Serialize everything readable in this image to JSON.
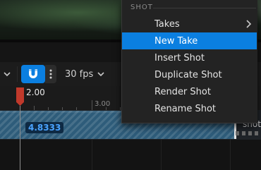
{
  "context_menu": {
    "header": "SHOT",
    "items": [
      {
        "label": "Takes",
        "has_submenu": true,
        "active": false
      },
      {
        "label": "New Take",
        "has_submenu": false,
        "active": true
      },
      {
        "label": "Insert Shot",
        "has_submenu": false,
        "active": false
      },
      {
        "label": "Duplicate Shot",
        "has_submenu": false,
        "active": false
      },
      {
        "label": "Render Shot",
        "has_submenu": false,
        "active": false
      },
      {
        "label": "Rename Shot",
        "has_submenu": false,
        "active": false
      }
    ]
  },
  "toolbar": {
    "frame_rate": "30 fps",
    "snap_enabled": true,
    "icons": [
      "chevron-down-icon",
      "magnet-icon",
      "kebab-menu-icon",
      "chevron-down-icon"
    ]
  },
  "timeline": {
    "playhead_time": "2.00",
    "ruler_label": "3.00",
    "shot_time": "4.8333",
    "next_shot_label": "snot"
  },
  "colors": {
    "accent": "#0b7fe0",
    "playhead": "#c0392b",
    "shot_fill": "#2e5c7a",
    "shot_time_text": "#4aa3ff",
    "menu_bg": "#232323"
  }
}
